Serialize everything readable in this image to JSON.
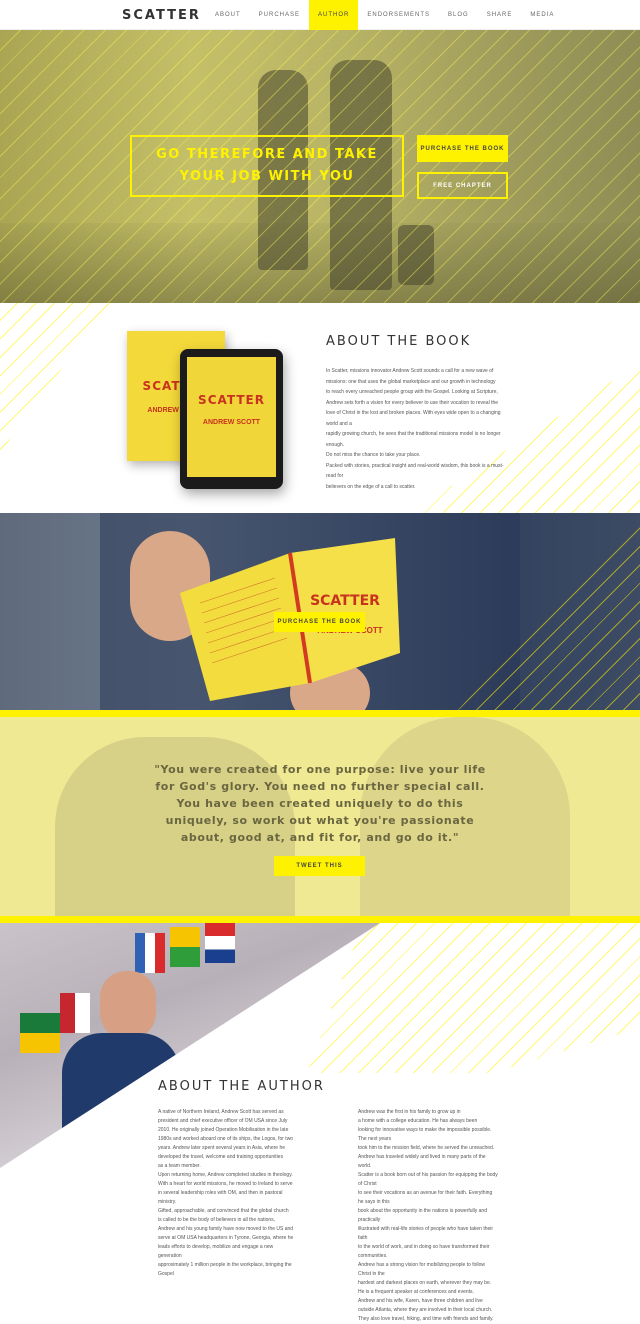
{
  "brand": "SCATTER",
  "nav": [
    "ABOUT",
    "PURCHASE",
    "AUTHOR",
    "ENDORSEMENTS",
    "BLOG",
    "SHARE",
    "MEDIA"
  ],
  "colors": {
    "accent": "#fff200",
    "text": "#333333"
  },
  "hero": {
    "title": "GO THEREFORE AND TAKE\nYOUR JOB WITH YOU",
    "purchase_label": "PURCHASE THE BOOK",
    "free_chapter_label": "FREE CHAPTER"
  },
  "about_book": {
    "heading": "ABOUT THE BOOK",
    "cover_title": "SCATTER",
    "cover_author": "ANDREW SCOTT",
    "paragraphs": [
      "In Scatter, missions innovator Andrew Scott sounds a call for a new wave of",
      "missions: one that uses the global marketplace and our growth in technology",
      "to reach every unreached people group with the Gospel. Looking at Scripture,",
      "Andrew sets forth a vision for every believer to use their vocation to reveal the",
      "love of Christ in the lost and broken places. With eyes wide open to a changing world and a",
      "rapidly growing church, he sees that the traditional missions model is no longer enough.",
      "Do not miss the chance to take your place.",
      "Packed with stories, practical insight and real-world wisdom, this book is a must-read for",
      "believers on the edge of a call to scatter."
    ]
  },
  "reading": {
    "purchase_label": "PURCHASE THE BOOK"
  },
  "quote": {
    "text": "\"You were created for one purpose: live your life for God's glory. You need no further special call. You have been created uniquely to do this uniquely, so work out what you're passionate about, good at, and fit for, and go do it.\"",
    "tweet_label": "TWEET THIS"
  },
  "about_author": {
    "heading": "ABOUT THE AUTHOR",
    "col1": [
      "A native of Northern Ireland, Andrew Scott has served as",
      "president and chief executive officer of OM USA since July",
      "2010. He originally joined Operation Mobilisation in the late",
      "1980s and worked aboard one of its ships, the Logos, for two",
      "years. Andrew later spent several years in Asia, where he",
      "developed the travel, welcome and training opportunities",
      "as a team member.",
      "Upon returning home, Andrew completed studies in theology.",
      "With a heart for world missions, he moved to Ireland to serve",
      "in several leadership roles with OM, and then in pastoral ministry.",
      "Gifted, approachable, and convinced that the global church",
      "is called to be the body of believers in all the nations,",
      "Andrew and his young family have now moved to the US and",
      "serve at OM USA headquarters in Tyrone, Georgia, where he",
      "leads efforts to develop, mobilize and engage a new generation",
      "approximately 1 million people in the workplace, bringing the Gospel"
    ],
    "col2": [
      "Andrew was the first in his family to grow up in",
      "a home with a college education. He has always been",
      "looking for innovative ways to make the impossible possible. The next years",
      "took him to the mission field, where he served the unreached.",
      "Andrew has traveled widely and lived in many parts of the world.",
      "Scatter is a book born out of his passion for equipping the body of Christ",
      "to see their vocations as an avenue for their faith. Everything he says in this",
      "book about the opportunity in the nations is powerfully and practically",
      "illustrated with real-life stories of people who have taken their faith",
      "to the world of work, and in doing so have transformed their communities.",
      "Andrew has a strong vision for mobilizing people to follow Christ in the",
      "hardest and darkest places on earth, wherever they may be.",
      "He is a frequent speaker at conferences and events.",
      "Andrew and his wife, Karen, have three children and live",
      "outside Atlanta, where they are involved in their local church.",
      "They also love travel, hiking, and time with friends and family."
    ]
  }
}
